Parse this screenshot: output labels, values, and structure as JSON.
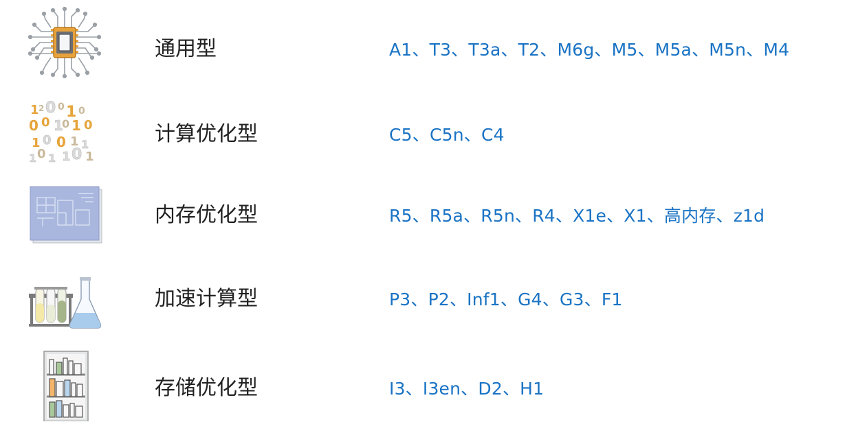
{
  "rows": [
    {
      "icon": "cpu-chip-icon",
      "category": "通用型",
      "types": "A1、T3、T3a、T2、M6g、M5、M5a、M5n、M4"
    },
    {
      "icon": "binary-digits-icon",
      "category": "计算优化型",
      "types": "C5、C5n、C4"
    },
    {
      "icon": "blueprint-icon",
      "category": "内存优化型",
      "types": "R5、R5a、R5n、R4、X1e、X1、高内存、z1d"
    },
    {
      "icon": "test-tubes-flask-icon",
      "category": "加速计算型",
      "types": "P3、P2、Inf1、G4、G3、F1"
    },
    {
      "icon": "bookshelf-icon",
      "category": "存储优化型",
      "types": "I3、I3en、D2、H1"
    }
  ],
  "colors": {
    "category_text": "#222222",
    "types_text": "#1a73c4"
  }
}
